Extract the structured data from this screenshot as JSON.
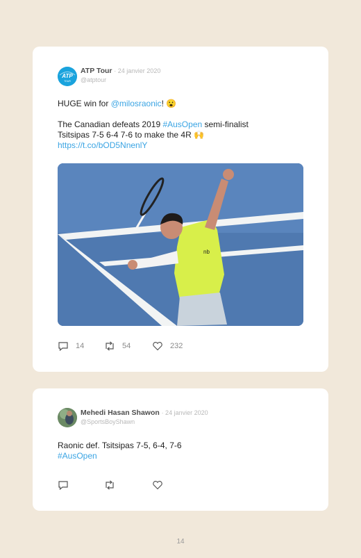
{
  "tweets": [
    {
      "author": "ATP Tour",
      "date": "· 24 janvier 2020",
      "handle": "@atptour",
      "avatar_text": "ATP",
      "avatar_subtext": "TOUR",
      "line1_pre": "HUGE win for ",
      "line1_mention": "@milosraonic",
      "line1_post": "! 😮",
      "line2_pre": "The Canadian defeats 2019 ",
      "line2_hashtag": "#AusOpen",
      "line2_post": " semi-finalist",
      "line3": "Tsitsipas 7-5 6-4 7-6 to make the 4R 🙌",
      "link": "https://t.co/bOD5NnenlY",
      "replies": "14",
      "retweets": "54",
      "likes": "232"
    },
    {
      "author": "Mehedi Hasan Shawon",
      "date": "· 24 janvier 2020",
      "handle": "@SportsBoyShawn",
      "line1": "Raonic def. Tsitsipas 7-5, 6-4, 7-6",
      "hashtag": "#AusOpen"
    }
  ],
  "page_number": "14",
  "colors": {
    "page_background": "#f1e8da",
    "link": "#3aa4e3",
    "court": "#4f79b0",
    "shirt": "#d8ef4a"
  },
  "icons": [
    "reply-icon",
    "retweet-icon",
    "like-icon"
  ]
}
